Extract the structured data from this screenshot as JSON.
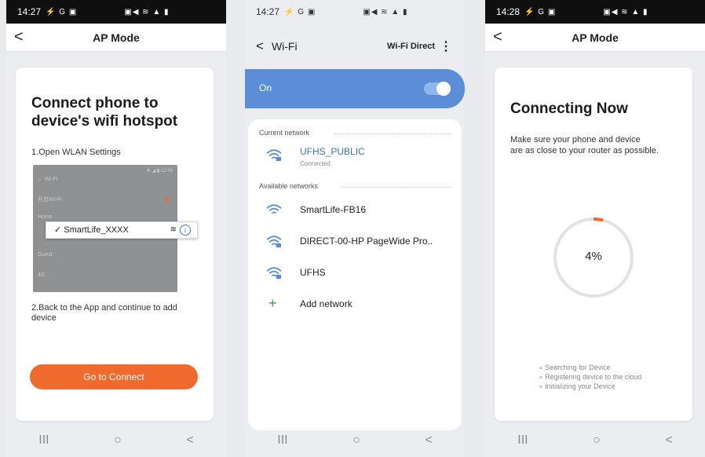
{
  "screen1": {
    "status": {
      "time": "14:27",
      "left_icons": "⚡ G ▣",
      "right_icons": "▣◀ ≋ ▲ ▮"
    },
    "appbar": {
      "back": "<",
      "title": "AP Mode"
    },
    "headline": "Connect phone to device's wifi hotspot",
    "step1": "1.Open WLAN Settings",
    "mock_rows": [
      "← Wi-Fi",
      "开启Wi-Fi",
      "Home",
      "Guest",
      "4G"
    ],
    "mock_status": "▼ ◢ ▮ 12:00",
    "highlight_network": "✓ SmartLife_XXXX",
    "highlight_info": "i",
    "step2": "2.Back to the App and continue to add device",
    "button": "Go to Connect",
    "nav": [
      "III",
      "○",
      "<"
    ]
  },
  "screen2": {
    "status": {
      "time": "14:27",
      "left_icons": "⚡ G ▣",
      "right_icons": "▣◀ ≋ ▲ ▮"
    },
    "header": {
      "back": "<",
      "title": "Wi-Fi",
      "action": "Wi-Fi Direct",
      "menu": "⋮"
    },
    "toggle_label": "On",
    "toggle_on": true,
    "current_label": "Current network",
    "current_network": {
      "name": "UFHS_PUBLIC",
      "status": "Connected"
    },
    "available_label": "Available networks",
    "networks": [
      "SmartLife-FB16",
      "DIRECT-00-HP PageWide Pro..",
      "UFHS"
    ],
    "add_network": "Add network",
    "add_icon": "+",
    "nav": [
      "III",
      "○",
      "<"
    ]
  },
  "screen3": {
    "status": {
      "time": "14:28",
      "left_icons": "⚡ G ▣",
      "right_icons": "▣◀ ≋ ▲ ▮"
    },
    "appbar": {
      "back": "<",
      "title": "AP Mode"
    },
    "headline": "Connecting Now",
    "subtitle_line1": "Make sure your phone and device",
    "subtitle_line2": "are as close to your router as possible.",
    "progress_percent": 4,
    "progress_label": "4%",
    "checklist": [
      "Searching for Device",
      "Registering device to the cloud",
      "Initializing your Device"
    ],
    "nav": [
      "III",
      "○",
      "<"
    ]
  },
  "colors": {
    "accent": "#ef6a2c",
    "blue": "#5b8ed6",
    "link_blue": "#3b72c8"
  }
}
